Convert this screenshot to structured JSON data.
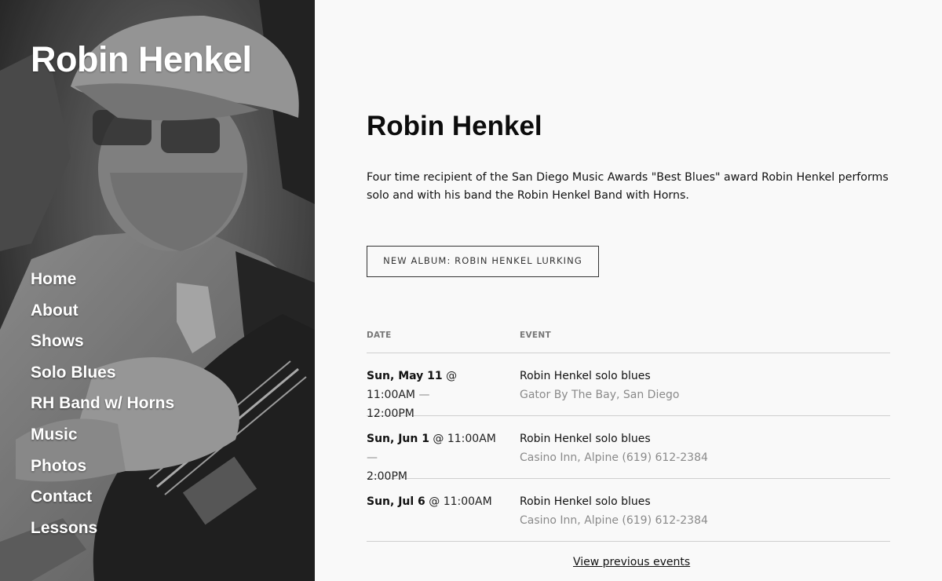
{
  "site": {
    "title": "Robin Henkel"
  },
  "nav": [
    {
      "label": "Home"
    },
    {
      "label": "About"
    },
    {
      "label": "Shows"
    },
    {
      "label": "Solo Blues"
    },
    {
      "label": "RH Band w/ Horns"
    },
    {
      "label": "Music"
    },
    {
      "label": "Photos"
    },
    {
      "label": "Contact"
    },
    {
      "label": "Lessons"
    }
  ],
  "main": {
    "title": "Robin Henkel",
    "intro": "Four time recipient of the San Diego Music Awards \"Best Blues\" award Robin Henkel performs solo and with his band the Robin Henkel Band with Horns.",
    "album_button": "NEW ALBUM: ROBIN HENKEL LURKING"
  },
  "events": {
    "headers": {
      "date": "DATE",
      "event": "EVENT"
    },
    "rows": [
      {
        "day": "Sun, May 11",
        "start": "@ 11:00AM",
        "sep": "—",
        "end": "12:00PM",
        "name": "Robin Henkel solo blues",
        "venue": "Gator By The Bay, San Diego"
      },
      {
        "day": "Sun, Jun 1",
        "start": "@ 11:00AM",
        "sep": "—",
        "end": "2:00PM",
        "name": "Robin Henkel solo blues",
        "venue": "Casino Inn, Alpine (619) 612-2384"
      },
      {
        "day": "Sun, Jul 6",
        "start": "@ 11:00AM",
        "sep": "",
        "end": "",
        "name": "Robin Henkel solo blues",
        "venue": "Casino Inn, Alpine (619) 612-2384"
      }
    ],
    "previous_link": "View previous events"
  },
  "colors": {
    "background": "#f9f9f9",
    "text": "#111111",
    "muted": "#8a8a8a",
    "divider": "#cfcfcf"
  }
}
